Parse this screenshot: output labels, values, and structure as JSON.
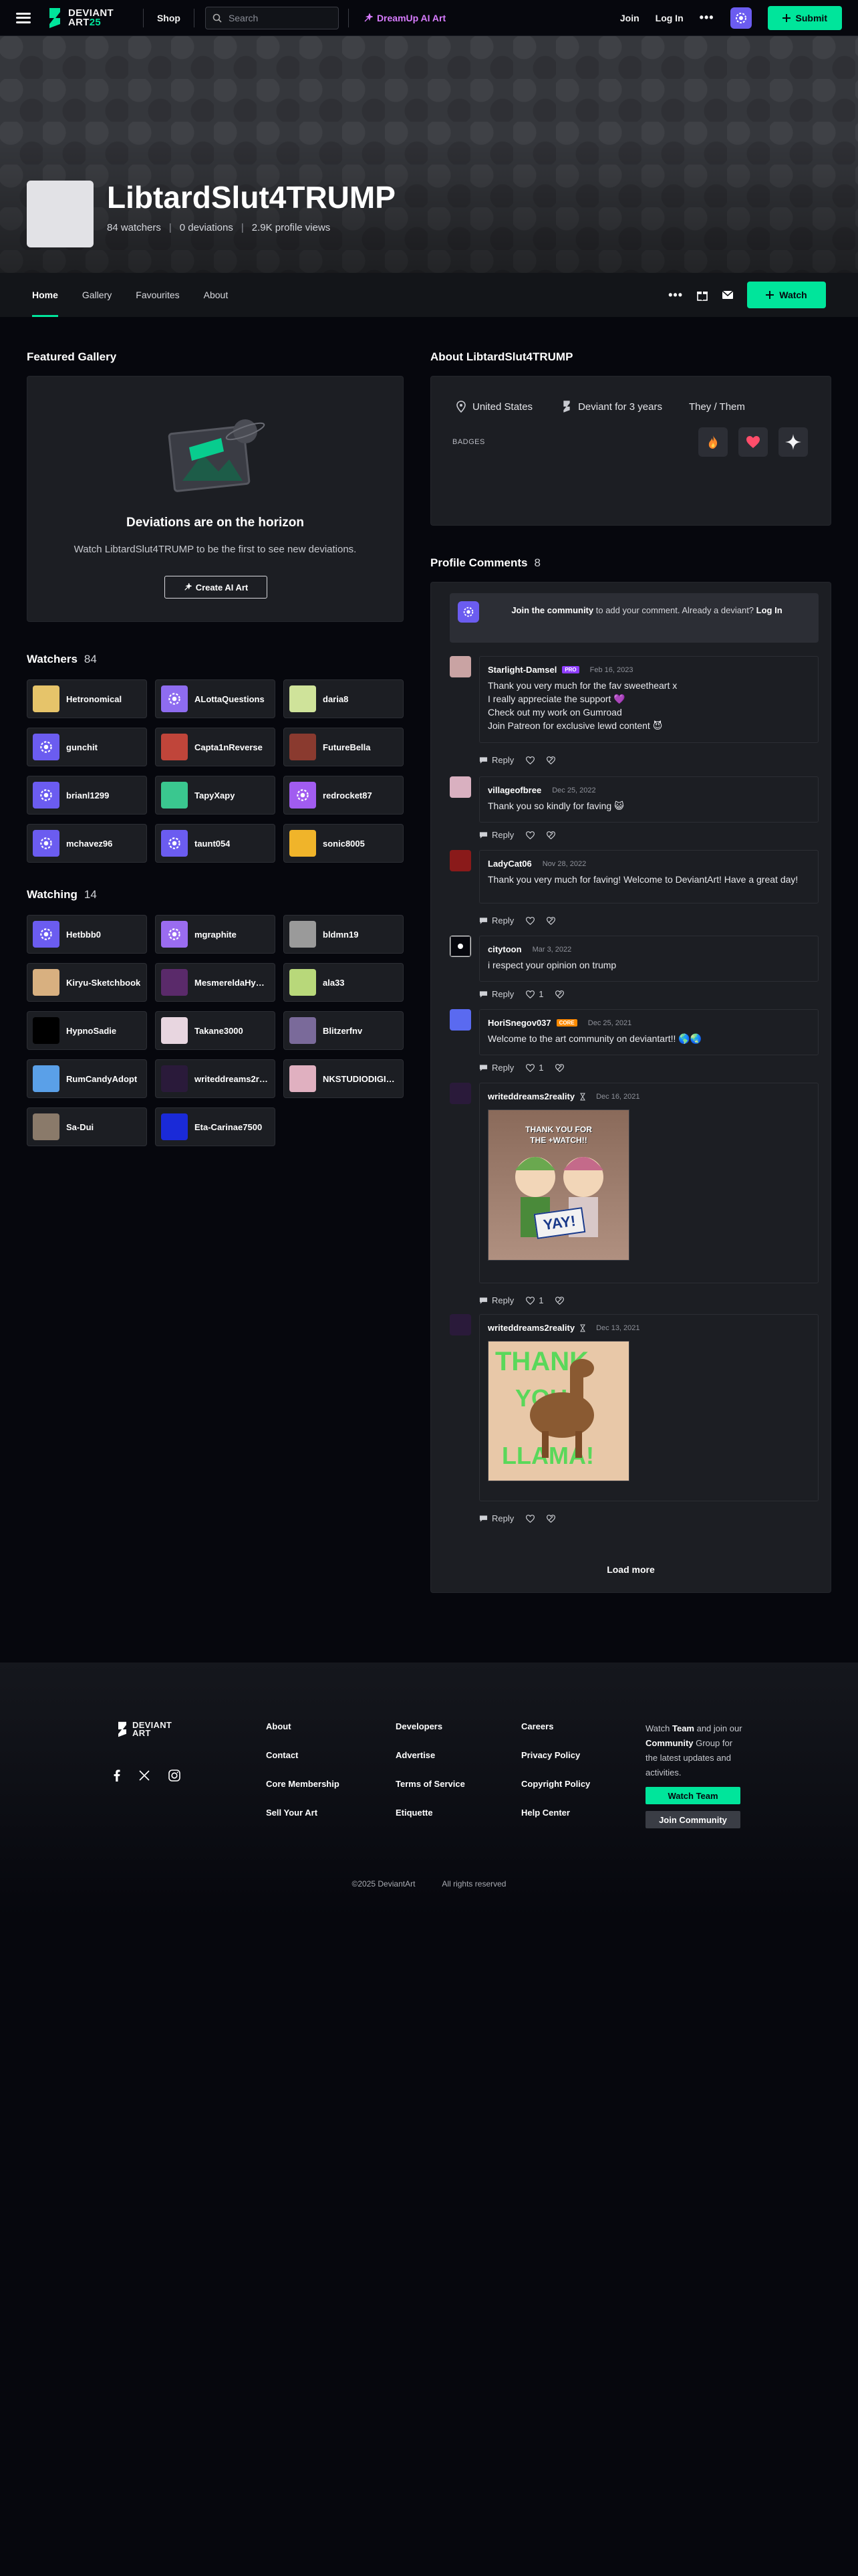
{
  "header": {
    "logo_word1": "DEVIANT",
    "logo_word2": "ART",
    "logo_num": "25",
    "shop": "Shop",
    "search_placeholder": "Search",
    "dreamup": "DreamUp AI Art",
    "join": "Join",
    "login": "Log In",
    "more": "•••",
    "submit": "Submit",
    "accent": "#00e59b"
  },
  "profile": {
    "name": "LibtardSlut4TRUMP",
    "watchers": "84 watchers",
    "deviations": "0 deviations",
    "views": "2.9K profile views",
    "sep": "|"
  },
  "tabs": [
    "Home",
    "Gallery",
    "Favourites",
    "About"
  ],
  "watch_button": "Watch",
  "featured": {
    "title": "Featured Gallery",
    "heading": "Deviations are on the horizon",
    "sub": "Watch LibtardSlut4TRUMP to be the first to see new deviations.",
    "button": "Create AI Art"
  },
  "watchers": {
    "title": "Watchers",
    "count": "84",
    "users": [
      {
        "name": "Hetronomical",
        "color": "#e6c46a"
      },
      {
        "name": "ALottaQuestions",
        "color": "#8e6cf0"
      },
      {
        "name": "daria8",
        "color": "#cfe39a"
      },
      {
        "name": "gunchit",
        "color": "#6b5cf0"
      },
      {
        "name": "Capta1nReverse",
        "color": "#c0453a"
      },
      {
        "name": "FutureBella",
        "color": "#8a3a2f"
      },
      {
        "name": "brianl1299",
        "color": "#6b5cf0"
      },
      {
        "name": "TapyXapy",
        "color": "#3ac78f"
      },
      {
        "name": "redrocket87",
        "color": "#a15cf0"
      },
      {
        "name": "mchavez96",
        "color": "#6b5cf0"
      },
      {
        "name": "taunt054",
        "color": "#6b5cf0"
      },
      {
        "name": "sonic8005",
        "color": "#f0b42a"
      }
    ]
  },
  "watching": {
    "title": "Watching",
    "count": "14",
    "users": [
      {
        "name": "Hetbbb0",
        "color": "#6b5cf0"
      },
      {
        "name": "mgraphite",
        "color": "#9a6cf0"
      },
      {
        "name": "bldmn19",
        "color": "#9a9a9a"
      },
      {
        "name": "Kiryu-Sketchbook",
        "color": "#d8b080"
      },
      {
        "name": "MesmereldaHyperion",
        "color": "#5a2a6a"
      },
      {
        "name": "ala33",
        "color": "#b8d87a"
      },
      {
        "name": "HypnoSadie",
        "color": "#000000"
      },
      {
        "name": "Takane3000",
        "color": "#e8d6e0"
      },
      {
        "name": "Blitzerfnv",
        "color": "#7a6a9a"
      },
      {
        "name": "RumCandyAdopt",
        "color": "#5aa0e8"
      },
      {
        "name": "writeddreams2reality",
        "color": "#2a1a3a"
      },
      {
        "name": "NKSTUDIODIGITALART",
        "color": "#e0b0c0"
      },
      {
        "name": "Sa-Dui",
        "color": "#8a7a6a"
      },
      {
        "name": "Eta-Carinae7500",
        "color": "#1a2ad8"
      }
    ]
  },
  "about": {
    "title": "About LibtardSlut4TRUMP",
    "country": "United States",
    "deviant_for": "Deviant for 3 years",
    "pronouns": "They / Them",
    "badges_label": "BADGES"
  },
  "comments": {
    "title": "Profile Comments",
    "count": "8",
    "join_strong": "Join the community",
    "join_rest": " to add your comment. Already a deviant? ",
    "login": "Log In",
    "reply": "Reply",
    "load_more": "Load more",
    "items": [
      {
        "user": "Starlight-Damsel",
        "tag": "PRO",
        "date": "Feb 16, 2023",
        "lines": [
          "Thank you very much for the fav sweetheart x",
          "I really appreciate the support 💜",
          "Check out my work on Gumroad",
          "Join Patreon for exclusive lewd content 😈"
        ],
        "likes": ""
      },
      {
        "user": "villageofbree",
        "tag": "",
        "date": "Dec 25, 2022",
        "lines": [
          "Thank you so kindly for faving 😺"
        ],
        "likes": ""
      },
      {
        "user": "LadyCat06",
        "tag": "",
        "date": "Nov 28, 2022",
        "lines": [
          "Thank you very much for faving! Welcome to DeviantArt! Have a great day!"
        ],
        "likes": ""
      },
      {
        "user": "citytoon",
        "tag": "",
        "date": "Mar 3, 2022",
        "lines": [
          "i respect your opinion on trump"
        ],
        "likes": "1"
      },
      {
        "user": "HoriSnegov037",
        "tag": "CORE",
        "date": "Dec 25, 2021",
        "lines": [
          "Welcome to the art community on deviantart!! 🌎🌏"
        ],
        "likes": "1"
      },
      {
        "user": "writeddreams2reality",
        "tag": "",
        "date": "Dec 16, 2021",
        "image_text": [
          "THANK YOU FOR",
          "THE +WATCH!!",
          "YAY!"
        ],
        "likes": "1"
      },
      {
        "user": "writeddreams2reality",
        "tag": "",
        "date": "Dec 13, 2021",
        "image_text": [
          "THANK",
          "YOU",
          "LLAMA!"
        ],
        "likes": ""
      }
    ]
  },
  "footer": {
    "col1": [
      "About",
      "Contact",
      "Core Membership",
      "Sell Your Art"
    ],
    "col2": [
      "Developers",
      "Advertise",
      "Terms of Service",
      "Etiquette"
    ],
    "col3": [
      "Careers",
      "Privacy Policy",
      "Copyright Policy",
      "Help Center"
    ],
    "watch_text_1": "Watch ",
    "watch_team": "Team",
    "watch_text_2": " and join our ",
    "watch_community": "Community",
    "watch_text_3": " Group for the latest updates and activities.",
    "btn_watch_team": "Watch Team",
    "btn_join_community": "Join Community",
    "copyright": "©2025 DeviantArt",
    "rights": "All rights reserved"
  }
}
